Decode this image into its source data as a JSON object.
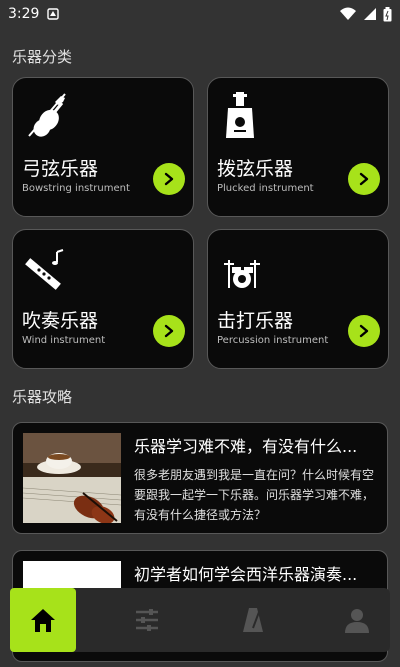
{
  "status_bar": {
    "time": "3:29"
  },
  "categories_section": {
    "title": "乐器分类"
  },
  "categories": [
    {
      "name": "弓弦乐器",
      "sub": "Bowstring instrument",
      "icon": "violin-icon"
    },
    {
      "name": "拨弦乐器",
      "sub": "Plucked instrument",
      "icon": "guitar-icon"
    },
    {
      "name": "吹奏乐器",
      "sub": "Wind instrument",
      "icon": "flute-icon"
    },
    {
      "name": "击打乐器",
      "sub": "Percussion instrument",
      "icon": "drum-icon"
    }
  ],
  "articles_section": {
    "title": "乐器攻略"
  },
  "articles": [
    {
      "title": "乐器学习难不难，有没有什么...",
      "desc": "很多老朋友遇到我是一直在问？什么时候有空要跟我一起学一下乐器。问乐器学习难不难，有没有什么捷径或方法？"
    },
    {
      "title": "初学者如何学会西洋乐器演奏..."
    }
  ],
  "tabbar": {
    "items": [
      {
        "name": "home",
        "icon": "home-icon",
        "active": true
      },
      {
        "name": "settings",
        "icon": "sliders-icon",
        "active": false
      },
      {
        "name": "metronome",
        "icon": "metronome-icon",
        "active": false
      },
      {
        "name": "profile",
        "icon": "person-icon",
        "active": false
      }
    ]
  },
  "colors": {
    "accent": "#a7e21a",
    "card_bg": "#0a0a0a",
    "page_bg": "#333333"
  }
}
